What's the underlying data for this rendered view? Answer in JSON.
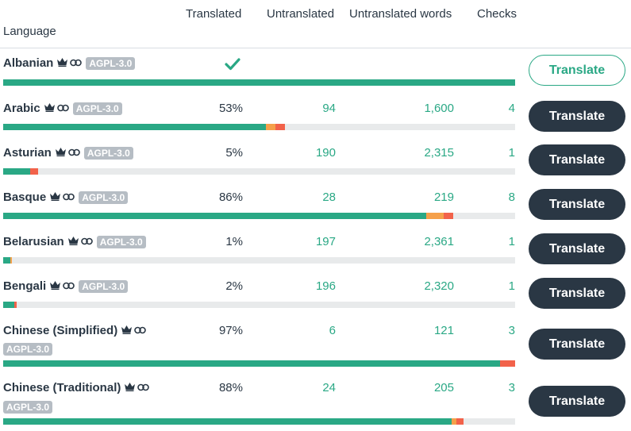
{
  "headers": {
    "language": "Language",
    "translated": "Translated",
    "untranslated": "Untranslated",
    "untranslated_words": "Untranslated words",
    "checks": "Checks"
  },
  "colors": {
    "accent": "#2aa885",
    "dark": "#2a3744",
    "badge": "#b6bdc4",
    "bar_bg": "#e8eaeb",
    "warn": "#f5a04a",
    "error": "#f2624a"
  },
  "rows": [
    {
      "language": "Albanian",
      "license": "AGPL-3.0",
      "translated": "",
      "untranslated": "",
      "untranslated_words": "",
      "checks": "",
      "button": "Translate",
      "progress": {
        "translated": 100,
        "warn": 0,
        "error": 0
      },
      "complete": true
    },
    {
      "language": "Arabic",
      "license": "AGPL-3.0",
      "translated": "53%",
      "untranslated": "94",
      "untranslated_words": "1,600",
      "checks": "4",
      "button": "Translate",
      "progress": {
        "translated": 51.3,
        "warn": 1.9,
        "error": 1.9
      }
    },
    {
      "language": "Asturian",
      "license": "AGPL-3.0",
      "translated": "5%",
      "untranslated": "190",
      "untranslated_words": "2,315",
      "checks": "1",
      "button": "Translate",
      "progress": {
        "translated": 5.3,
        "warn": 0,
        "error": 1.5
      }
    },
    {
      "language": "Basque",
      "license": "AGPL-3.0",
      "translated": "86%",
      "untranslated": "28",
      "untranslated_words": "219",
      "checks": "8",
      "button": "Translate",
      "progress": {
        "translated": 82.6,
        "warn": 3.4,
        "error": 1.9
      }
    },
    {
      "language": "Belarusian",
      "license": "AGPL-3.0",
      "translated": "1%",
      "untranslated": "197",
      "untranslated_words": "2,361",
      "checks": "1",
      "button": "Translate",
      "progress": {
        "translated": 1.4,
        "warn": 0.3,
        "error": 0
      }
    },
    {
      "language": "Bengali",
      "license": "AGPL-3.0",
      "translated": "2%",
      "untranslated": "196",
      "untranslated_words": "2,320",
      "checks": "1",
      "button": "Translate",
      "progress": {
        "translated": 2.2,
        "warn": 0,
        "error": 0.4
      }
    },
    {
      "language": "Chinese (Simplified)",
      "license": "AGPL-3.0",
      "translated": "97%",
      "untranslated": "6",
      "untranslated_words": "121",
      "checks": "3",
      "button": "Translate",
      "progress": {
        "translated": 97.1,
        "warn": 0,
        "error": 2.9
      }
    },
    {
      "language": "Chinese (Traditional)",
      "license": "AGPL-3.0",
      "translated": "88%",
      "untranslated": "24",
      "untranslated_words": "205",
      "checks": "3",
      "button": "Translate",
      "progress": {
        "translated": 87.6,
        "warn": 1.0,
        "error": 1.4
      }
    }
  ]
}
